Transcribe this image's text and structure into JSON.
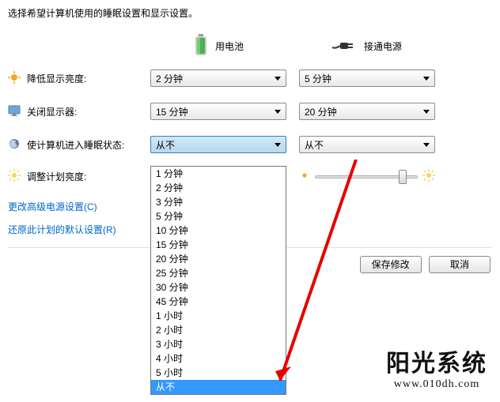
{
  "header": {
    "description": "选择希望计算机使用的睡眠设置和显示设置。"
  },
  "columns": {
    "battery": "用电池",
    "plugged": "接通电源"
  },
  "rows": {
    "dim": {
      "label": "降低显示亮度:",
      "battery": "2 分钟",
      "plugged": "5 分钟"
    },
    "off": {
      "label": "关闭显示器:",
      "battery": "15 分钟",
      "plugged": "20 分钟"
    },
    "sleep": {
      "label": "使计算机进入睡眠状态:",
      "battery": "从不",
      "plugged": "从不"
    },
    "bright": {
      "label": "调整计划亮度:"
    }
  },
  "dropdown": {
    "items": [
      "1 分钟",
      "2 分钟",
      "3 分钟",
      "5 分钟",
      "10 分钟",
      "15 分钟",
      "20 分钟",
      "25 分钟",
      "30 分钟",
      "45 分钟",
      "1 小时",
      "2 小时",
      "3 小时",
      "4 小时",
      "5 小时",
      "从不"
    ],
    "highlighted": "从不"
  },
  "links": {
    "advanced": "更改高级电源设置(C)",
    "restore": "还原此计划的默认设置(R)"
  },
  "buttons": {
    "save": "保存修改",
    "cancel": "取消"
  },
  "watermark": {
    "cn": "阳光系统",
    "url": "www.010dh.com"
  },
  "colors": {
    "highlight": "#3399ff",
    "link": "#0066cc"
  }
}
